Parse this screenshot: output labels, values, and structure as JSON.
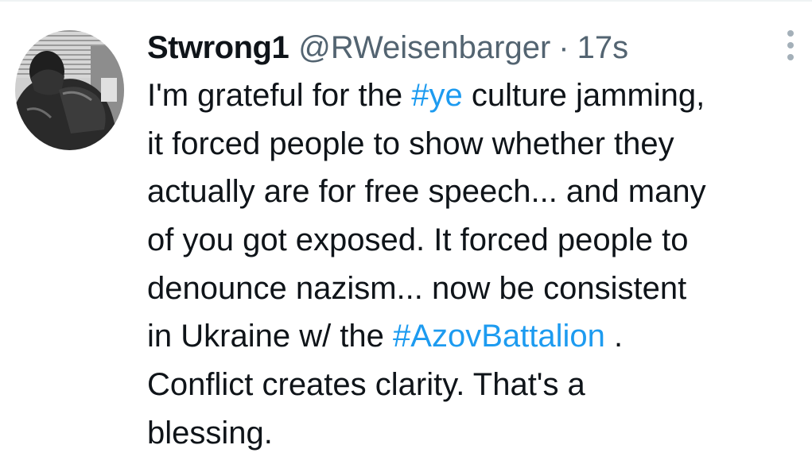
{
  "tweet": {
    "display_name": "Stwrong1",
    "handle": "@RWeisenbarger",
    "separator": "·",
    "time": "17s",
    "avatar_icon": "profile-photo-avatar",
    "more_icon": "vertical-ellipsis-icon",
    "colors": {
      "text": "#0f1419",
      "secondary": "#536471",
      "link": "#1d9bf0"
    },
    "lines": [
      {
        "a": "I'm grateful for the ",
        "tag": "#ye",
        "b": " culture jamming,"
      },
      {
        "text": "it forced people to show whether they"
      },
      {
        "text": "actually are for free speech... and many"
      },
      {
        "text": "of you got exposed. It forced people to"
      },
      {
        "text": "denounce nazism... now be consistent"
      },
      {
        "a": "in Ukraine w/ the ",
        "tag": "#AzovBattalion",
        "b": " ."
      },
      {
        "text": "Conflict creates clarity. That's a"
      },
      {
        "text": "blessing."
      }
    ]
  }
}
